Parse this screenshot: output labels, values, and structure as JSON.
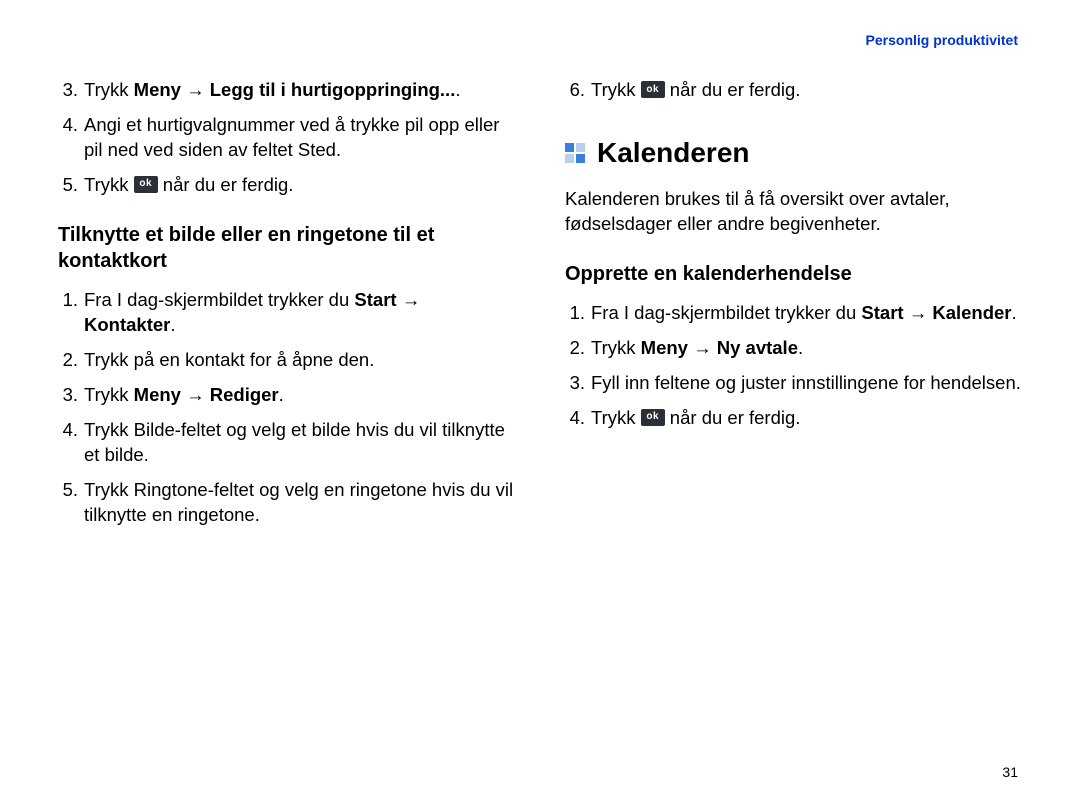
{
  "header": {
    "link": "Personlig produktivitet"
  },
  "page_number": "31",
  "left": {
    "list_a": [
      {
        "n": "3.",
        "pre": "Trykk ",
        "bold": "Meny → Legg til i hurtigoppringing...",
        "post": "."
      },
      {
        "n": "4.",
        "text": "Angi et hurtigvalgnummer ved å trykke pil opp eller pil ned ved siden av feltet Sted."
      },
      {
        "n": "5.",
        "text_pre": "Trykk ",
        "ok": true,
        "text_post": " når du er ferdig."
      }
    ],
    "subheading": "Tilknytte et bilde eller en ringetone til et kontaktkort",
    "list_b": [
      {
        "n": "1.",
        "pre": "Fra I dag-skjermbildet trykker du ",
        "bold": "Start → Kontakter",
        "post": "."
      },
      {
        "n": "2.",
        "text": "Trykk på en kontakt for å åpne den."
      },
      {
        "n": "3.",
        "pre": "Trykk ",
        "bold": "Meny → Rediger",
        "post": "."
      },
      {
        "n": "4.",
        "text": "Trykk Bilde-feltet og velg et bilde hvis du vil tilknytte et bilde."
      },
      {
        "n": "5.",
        "text": "Trykk Ringtone-feltet og velg en ringetone hvis du vil tilknytte en ringetone."
      }
    ]
  },
  "right": {
    "list_top": [
      {
        "n": "6.",
        "text_pre": "Trykk ",
        "ok": true,
        "text_post": " når du er ferdig."
      }
    ],
    "section_heading": "Kalenderen",
    "intro": "Kalenderen brukes til å få oversikt over avtaler, fødselsdager eller andre begivenheter.",
    "subheading": "Opprette en kalenderhendelse",
    "list_b": [
      {
        "n": "1.",
        "pre": "Fra I dag-skjermbildet trykker du ",
        "bold": "Start → Kalender",
        "post": "."
      },
      {
        "n": "2.",
        "pre": "Trykk ",
        "bold": "Meny → Ny avtale",
        "post": "."
      },
      {
        "n": "3.",
        "text": "Fyll inn feltene og juster innstillingene for hendelsen."
      },
      {
        "n": "4.",
        "text_pre": "Trykk ",
        "ok": true,
        "text_post": " når du er ferdig."
      }
    ]
  }
}
